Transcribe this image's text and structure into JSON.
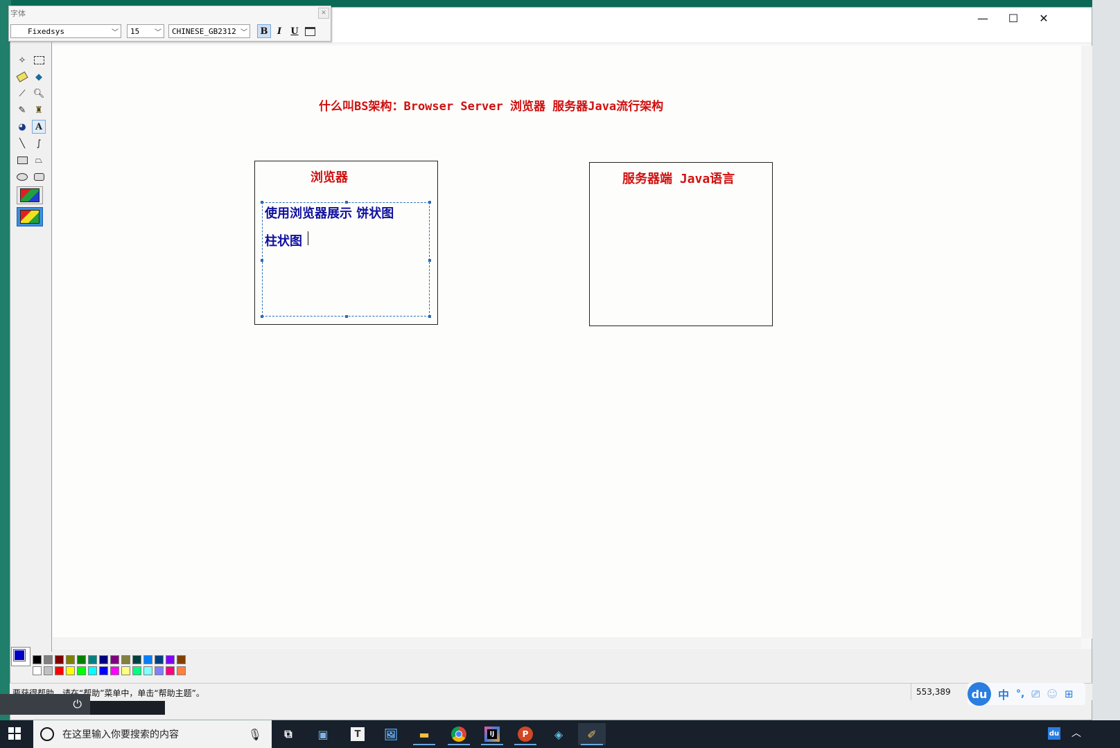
{
  "fontbar": {
    "title": "字体",
    "font_name": "Fixedsys",
    "font_size": "15",
    "charset": "CHINESE_GB2312",
    "bold_label": "B",
    "italic_label": "I",
    "underline_label": "U"
  },
  "window_controls": {
    "minimize": "—",
    "maximize": "☐",
    "close": "✕"
  },
  "canvas": {
    "heading": "什么叫BS架构：Browser Server 浏览器 服务器Java流行架构",
    "browser_box": {
      "label": "浏览器",
      "text_line1": "使用浏览器展示 饼状图",
      "text_line2": "柱状图"
    },
    "server_box": {
      "label": "服务器端 Java语言"
    }
  },
  "palette": {
    "foreground_color": "#0000c0",
    "background_color": "#ffffff",
    "row1": [
      "#000000",
      "#808080",
      "#800000",
      "#808000",
      "#008000",
      "#008080",
      "#000080",
      "#800080",
      "#808040",
      "#004040",
      "#0080ff",
      "#004080",
      "#8000ff",
      "#804000"
    ],
    "row2": [
      "#ffffff",
      "#c0c0c0",
      "#ff0000",
      "#ffff00",
      "#00ff00",
      "#00ffff",
      "#0000ff",
      "#ff00ff",
      "#ffff80",
      "#00ff80",
      "#80ffff",
      "#8080ff",
      "#ff0080",
      "#ff8040"
    ]
  },
  "status": {
    "help_text": "要获得帮助，请在“帮助”菜单中，单击“帮助主题”。",
    "coords": "553,389"
  },
  "ime": {
    "logo": "du",
    "lang": "中",
    "punct": "°,"
  },
  "taskbar": {
    "search_placeholder": "在这里输入你要搜索的内容",
    "tray_label": "du"
  }
}
